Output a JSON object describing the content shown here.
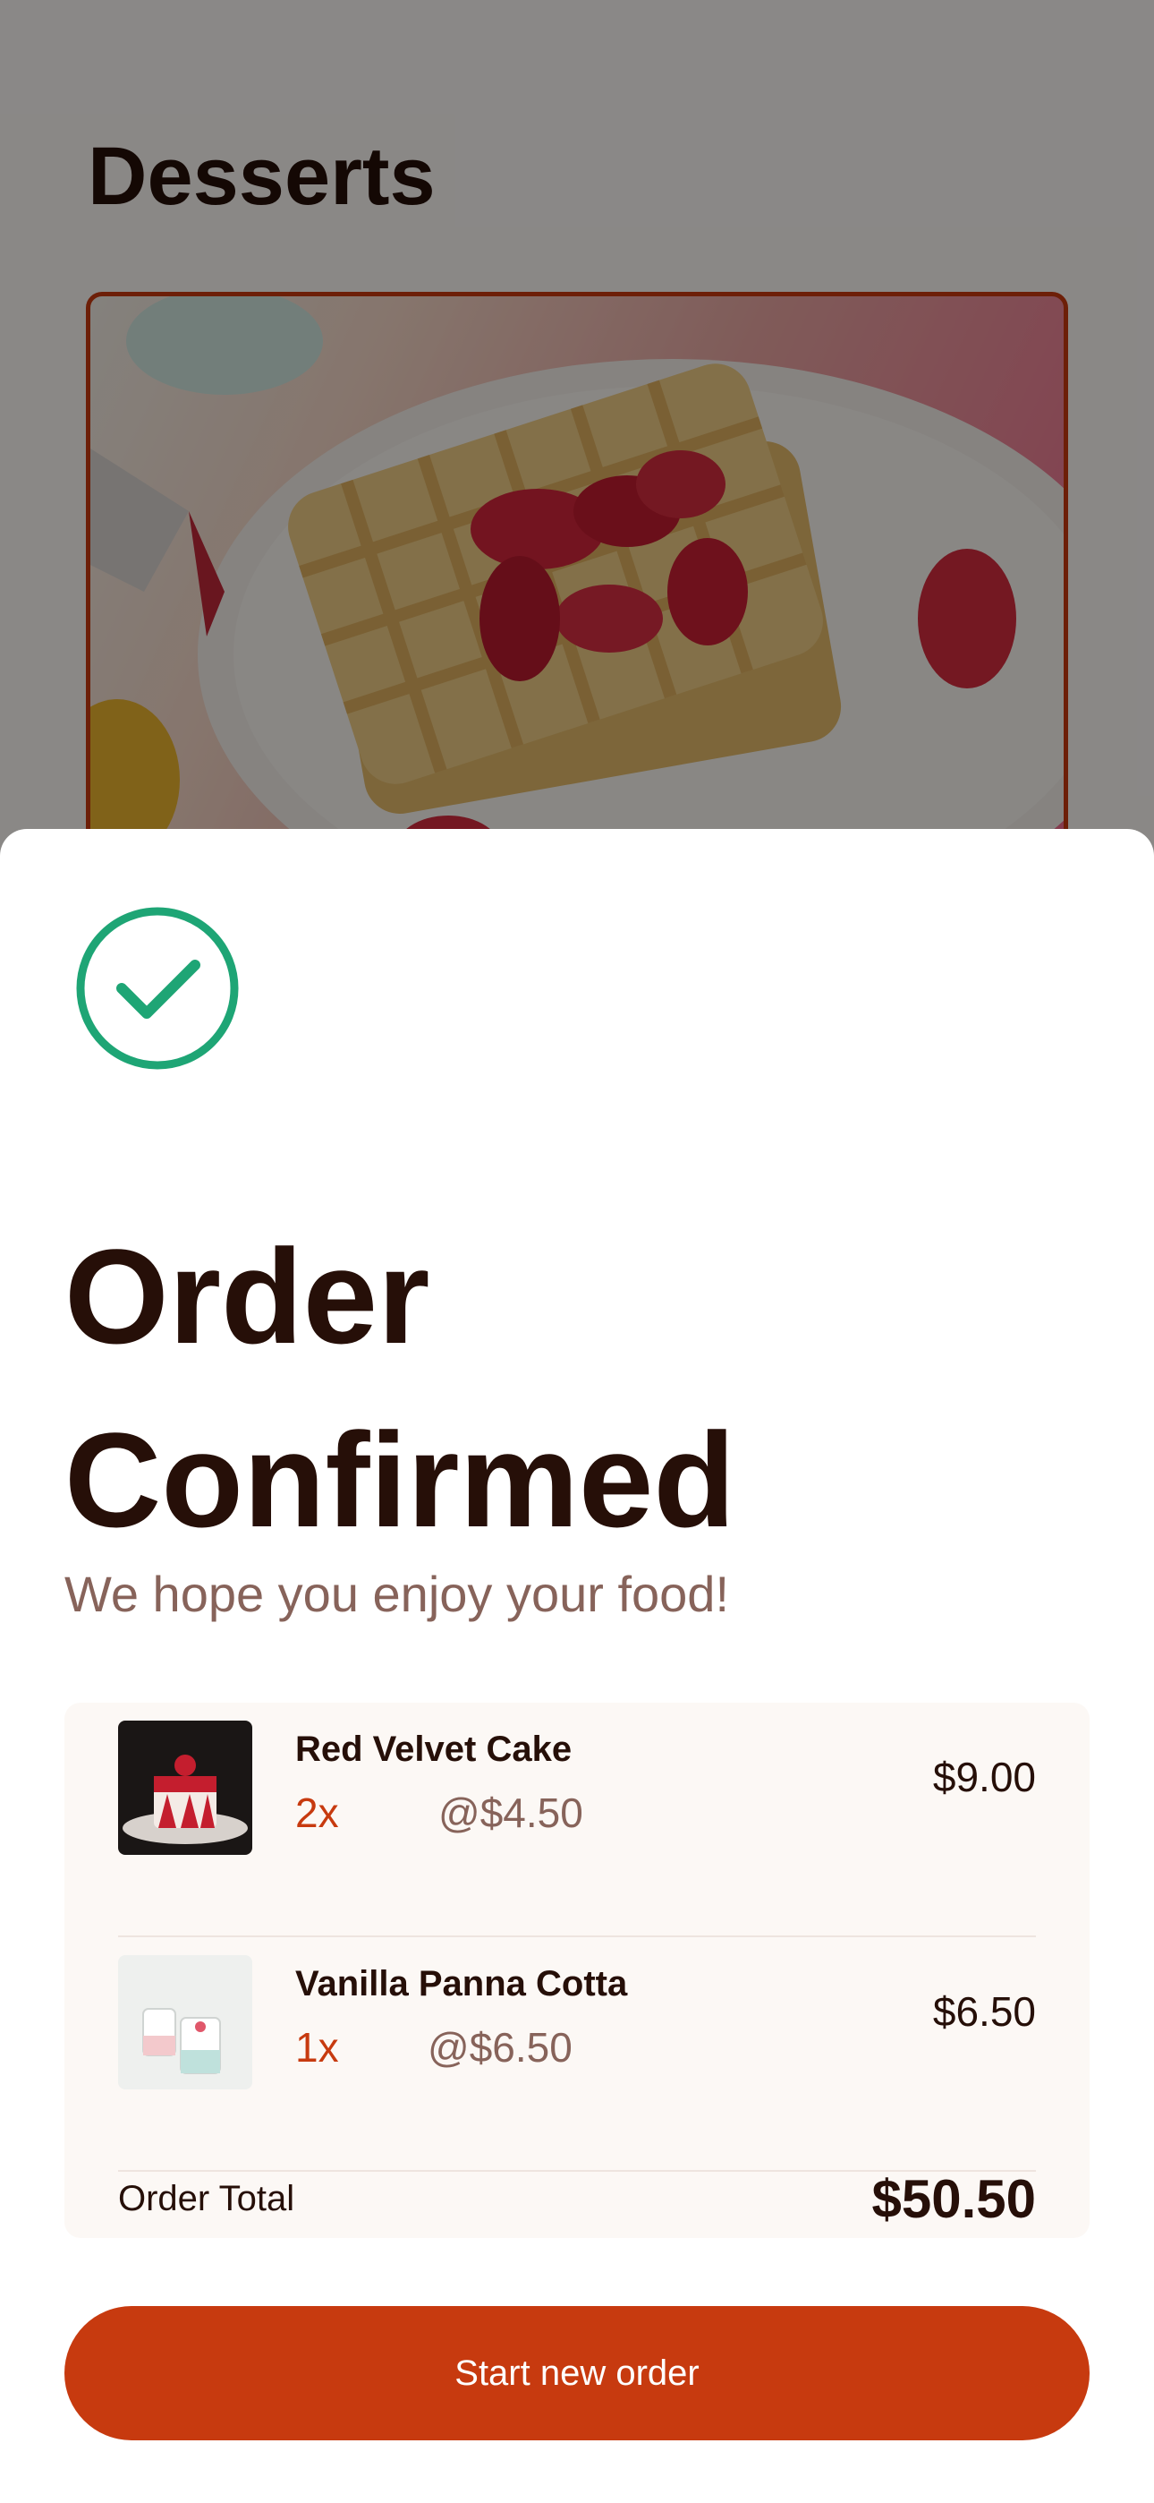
{
  "background_page": {
    "title": "Desserts"
  },
  "modal": {
    "title": "Order Confirmed",
    "subtitle": "We hope you enjoy your food!",
    "icon": "check-circle-icon",
    "accent_color": "#1ea575",
    "items": [
      {
        "name": "Red Velvet Cake",
        "quantity": "2x",
        "unit_price": "@$4.50",
        "line_total": "$9.00"
      },
      {
        "name": "Vanilla Panna Cotta",
        "quantity": "1x",
        "unit_price": "@$6.50",
        "line_total": "$6.50"
      }
    ],
    "total_label": "Order Total",
    "total_value": "$50.50",
    "button_label": "Start new order",
    "button_color": "#c73a0f"
  }
}
